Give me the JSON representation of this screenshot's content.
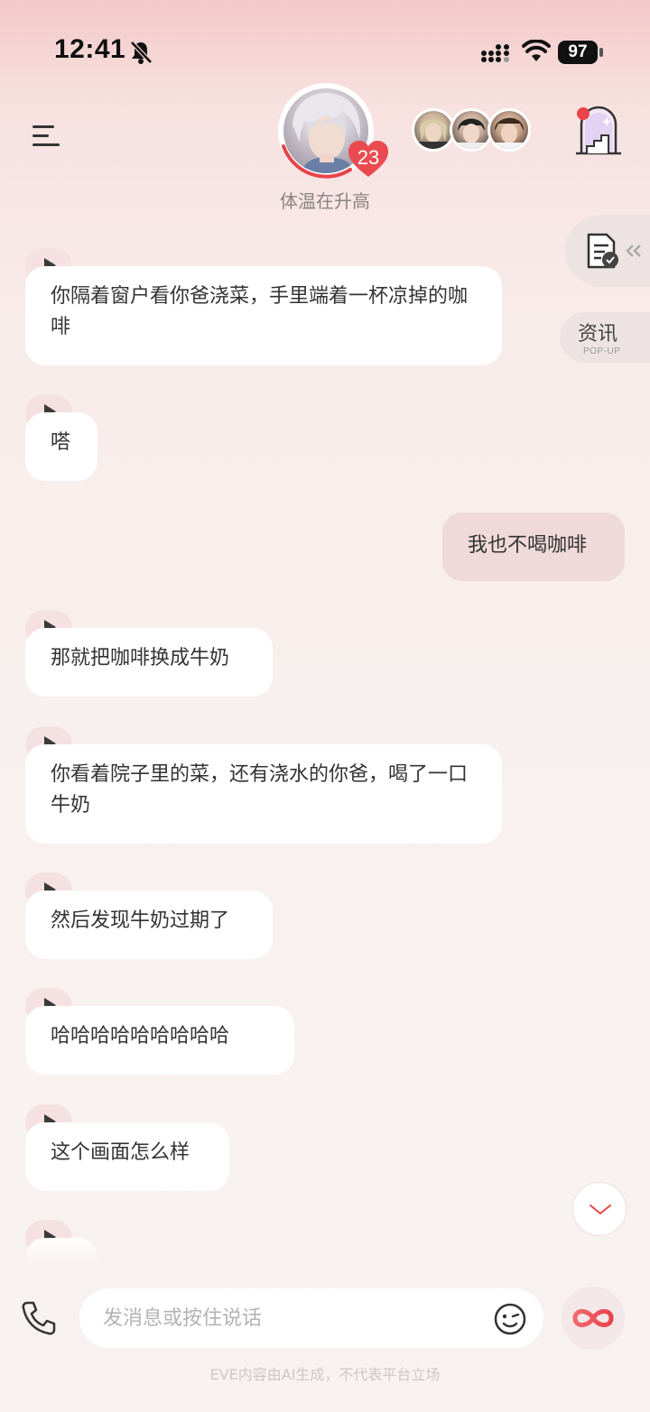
{
  "status_bar": {
    "time": "12:41",
    "battery": "97"
  },
  "header": {
    "affection_value": "23",
    "status_text": "体温在升高"
  },
  "side_widgets": {
    "popup_label": "资讯",
    "popup_sublabel": "POP-UP"
  },
  "messages": [
    {
      "role": "ai",
      "text": "你隔着窗户看你爸浇菜，手里端着一杯凉掉的咖啡"
    },
    {
      "role": "ai",
      "text": "嗒"
    },
    {
      "role": "user",
      "text": "我也不喝咖啡"
    },
    {
      "role": "ai",
      "text": "那就把咖啡换成牛奶"
    },
    {
      "role": "ai",
      "text": "你看着院子里的菜，还有浇水的你爸，喝了一口牛奶"
    },
    {
      "role": "ai",
      "text": "然后发现牛奶过期了"
    },
    {
      "role": "ai",
      "text": "哈哈哈哈哈哈哈哈哈"
    },
    {
      "role": "ai",
      "text": "这个画面怎么样"
    }
  ],
  "input": {
    "placeholder": "发消息或按住说话",
    "value": ""
  },
  "footer": {
    "disclaimer": "EVE内容由AI生成，不代表平台立场"
  },
  "colors": {
    "accent_red": "#e8444a",
    "user_bubble": "#efd9d9",
    "ai_bubble": "#ffffff"
  }
}
